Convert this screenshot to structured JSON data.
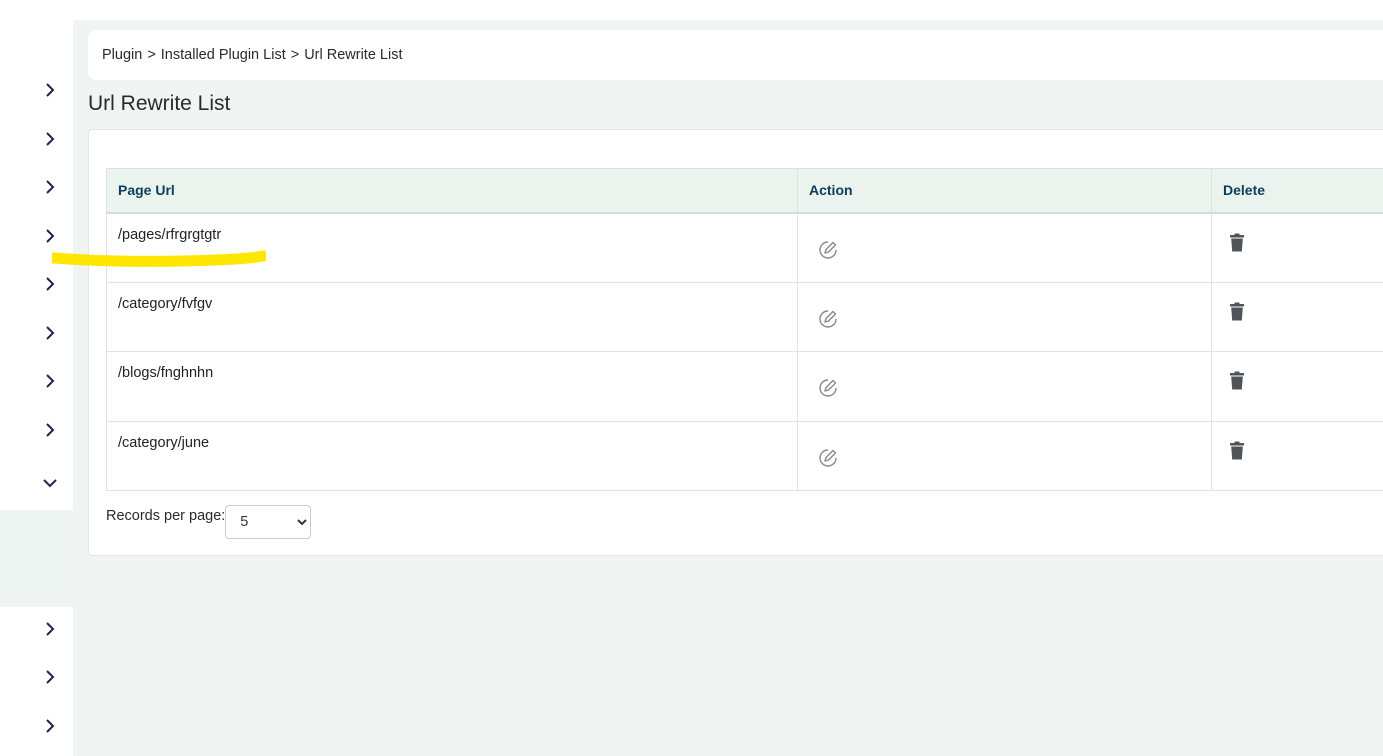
{
  "breadcrumb": {
    "items": [
      "Plugin",
      "Installed Plugin List",
      "Url Rewrite List"
    ],
    "separator": ">"
  },
  "page": {
    "title": "Url Rewrite List"
  },
  "table": {
    "headers": {
      "page_url": "Page Url",
      "action": "Action",
      "delete": "Delete"
    },
    "rows": [
      {
        "page_url": "/pages/rfrgrgtgtr"
      },
      {
        "page_url": "/category/fvfgv"
      },
      {
        "page_url": "/blogs/fnghnhn"
      },
      {
        "page_url": "/category/june"
      }
    ]
  },
  "pagination": {
    "records_label": "Records per page:",
    "records_value": "5",
    "options": [
      "5"
    ]
  },
  "icons": {
    "sidebar": "chevron-right-icon",
    "sidebar_open": "chevron-down-icon",
    "edit": "edit-icon",
    "delete": "trash-icon"
  },
  "colors": {
    "header_bg": "#eaf3ee",
    "header_text": "#0c3d5a",
    "highlight": "#ffe600",
    "chevron": "#2c1d4a"
  }
}
